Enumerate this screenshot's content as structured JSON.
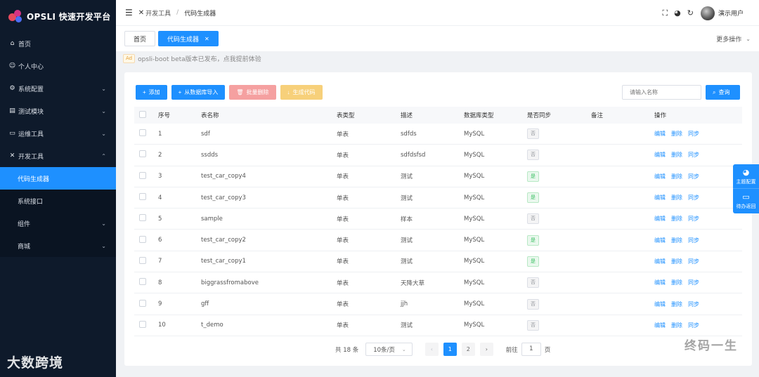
{
  "app": {
    "logo_text": "OPSLI 快速开发平台"
  },
  "sidebar": {
    "items": [
      {
        "label": "首页",
        "icon": "home-icon",
        "glyph": "⌂"
      },
      {
        "label": "个人中心",
        "icon": "user-icon",
        "glyph": "☺"
      },
      {
        "label": "系统配置",
        "icon": "gear-icon",
        "glyph": "⚙",
        "chevron": "⌄"
      },
      {
        "label": "测试模块",
        "icon": "briefcase-icon",
        "glyph": "▤",
        "chevron": "⌄"
      },
      {
        "label": "运维工具",
        "icon": "monitor-icon",
        "glyph": "▭",
        "chevron": "⌄"
      },
      {
        "label": "开发工具",
        "icon": "tools-icon",
        "glyph": "✕",
        "chevron": "⌃"
      }
    ],
    "subitems": [
      {
        "label": "代码生成器",
        "active": true
      },
      {
        "label": "系统接口"
      },
      {
        "label": "组件",
        "chevron": "⌄"
      },
      {
        "label": "商城",
        "chevron": "⌄"
      }
    ],
    "watermark": "大数跨境"
  },
  "header": {
    "breadcrumb_parent": "开发工具",
    "breadcrumb_current": "代码生成器",
    "user_name": "演示用户"
  },
  "tabs": {
    "home": "首页",
    "active": "代码生成器",
    "more_ops": "更多操作"
  },
  "notice": {
    "badge": "Ad",
    "text": "opsli-boot beta版本已发布，点我提前体验"
  },
  "toolbar": {
    "add": "添加",
    "import": "从数据库导入",
    "batch_delete": "批量删除",
    "generate": "生成代码",
    "search_placeholder": "请输入名称",
    "search": "查询"
  },
  "table": {
    "headers": [
      "序号",
      "表名称",
      "表类型",
      "描述",
      "数据库类型",
      "是否同步",
      "备注",
      "操作"
    ],
    "ops": [
      "编辑",
      "删除",
      "同步"
    ],
    "rows": [
      {
        "no": "1",
        "name": "sdf",
        "type": "单表",
        "desc": "sdfds",
        "db": "MySQL",
        "sync": "否",
        "synced": false,
        "remark": ""
      },
      {
        "no": "2",
        "name": "ssdds",
        "type": "单表",
        "desc": "sdfdsfsd",
        "db": "MySQL",
        "sync": "否",
        "synced": false,
        "remark": ""
      },
      {
        "no": "3",
        "name": "test_car_copy4",
        "type": "单表",
        "desc": "测试",
        "db": "MySQL",
        "sync": "是",
        "synced": true,
        "remark": ""
      },
      {
        "no": "4",
        "name": "test_car_copy3",
        "type": "单表",
        "desc": "测试",
        "db": "MySQL",
        "sync": "是",
        "synced": true,
        "remark": ""
      },
      {
        "no": "5",
        "name": "sample",
        "type": "单表",
        "desc": "样本",
        "db": "MySQL",
        "sync": "否",
        "synced": false,
        "remark": ""
      },
      {
        "no": "6",
        "name": "test_car_copy2",
        "type": "单表",
        "desc": "测试",
        "db": "MySQL",
        "sync": "是",
        "synced": true,
        "remark": ""
      },
      {
        "no": "7",
        "name": "test_car_copy1",
        "type": "单表",
        "desc": "测试",
        "db": "MySQL",
        "sync": "是",
        "synced": true,
        "remark": ""
      },
      {
        "no": "8",
        "name": "biggrassfromabove",
        "type": "单表",
        "desc": "天降大草",
        "db": "MySQL",
        "sync": "否",
        "synced": false,
        "remark": ""
      },
      {
        "no": "9",
        "name": "gff",
        "type": "单表",
        "desc": "jjh",
        "db": "MySQL",
        "sync": "否",
        "synced": false,
        "remark": ""
      },
      {
        "no": "10",
        "name": "t_demo",
        "type": "单表",
        "desc": "测试",
        "db": "MySQL",
        "sync": "否",
        "synced": false,
        "remark": ""
      }
    ]
  },
  "pagination": {
    "total": "共 18 条",
    "page_size": "10条/页",
    "pages": [
      "1",
      "2"
    ],
    "current_page": "1",
    "goto_label": "前往",
    "goto_value": "1",
    "goto_suffix": "页"
  },
  "float_panel": {
    "theme": "主题配置",
    "feedback": "待办返回"
  },
  "watermark_right": "终码一生",
  "colors": {
    "primary": "#1e90ff",
    "sidebar_bg": "#0e1a2b",
    "danger_light": "#f5a0a0",
    "warning_light": "#f7d07a",
    "success": "#3bbf63"
  }
}
